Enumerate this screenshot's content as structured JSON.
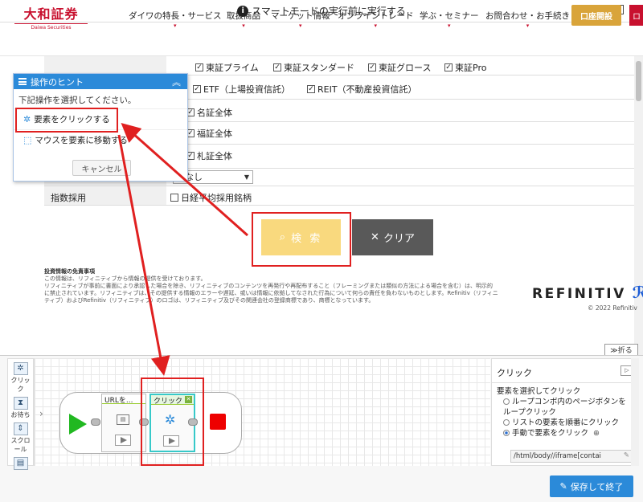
{
  "titlebar": {
    "info_icon": "i",
    "title": "スマートモードの実行前に実行する"
  },
  "site": {
    "logo_main": "大和証券",
    "logo_sub": "Daiwa Securities",
    "nav": [
      "ダイワの特長・サービス",
      "取扱商品",
      "マーケット情報",
      "オンライントレード",
      "学ぶ・セミナー",
      "お問合わせ・お手続き"
    ],
    "open_account": "口座開設",
    "login": "ロ"
  },
  "form": {
    "markets_row1": [
      "東証プライム",
      "東証スタンダード",
      "東証グロース",
      "東証Pro"
    ],
    "markets_row2": [
      "ETF（上場投資信託）",
      "REIT（不動産投資信託）"
    ],
    "regional": [
      "名証全体",
      "福証全体",
      "札証全体"
    ],
    "select_value": "なし",
    "index_label": "指数採用",
    "index_option": "日経平均採用銘柄"
  },
  "hint": {
    "title": "操作のヒント",
    "desc": "下記操作を選択してください。",
    "option_click": "要素をクリックする",
    "option_hover": "マウスを要素に移動する",
    "cancel": "キャンセル"
  },
  "buttons": {
    "search": "検 索",
    "clear": "クリア"
  },
  "disclaimer": {
    "heading": "投資情報の免責事項",
    "line1": "この情報は、リフィニティブから情報の提供を受けております。",
    "body": "リフィニティブが事前に書面により承認した場合を除き、リフィニティブのコンテンツを再発行や再配布すること（フレーミングまたは類似の方法による場合を含む）は、明示的に禁止されています。リフィニティブは、その提供する情報のエラーや遅延、或いは情報に依拠してなされた行為について何らの責任を負わないものとします。Refinitiv（リフィニティブ）およびRefinitiv（リフィニティブ）のロゴは、リフィニティブ及びその関連会社の登録商標であり、商標となっています。"
  },
  "refinitiv": {
    "logo": "REFINITIV",
    "copyright": "© 2022 Refinitiv"
  },
  "fold": "≫折る",
  "toolbox": [
    "クリック",
    "お待ち",
    "スクロール"
  ],
  "flow": {
    "node1_label": "URLを...",
    "node2_label": "クリック"
  },
  "props": {
    "title": "クリック",
    "section": "要素を選択してクリック",
    "opt1": "ループコンボ内のページボタンをループクリック",
    "opt2": "リストの要素を順番にクリック",
    "opt3": "手動で要素をクリック",
    "xpath": "/html/body//iframe[contai"
  },
  "save": "保存して終了",
  "colors": {
    "accent": "#2b8ad9",
    "brand": "#c8102e",
    "highlight": "#e02020",
    "search": "#f9d97e"
  }
}
